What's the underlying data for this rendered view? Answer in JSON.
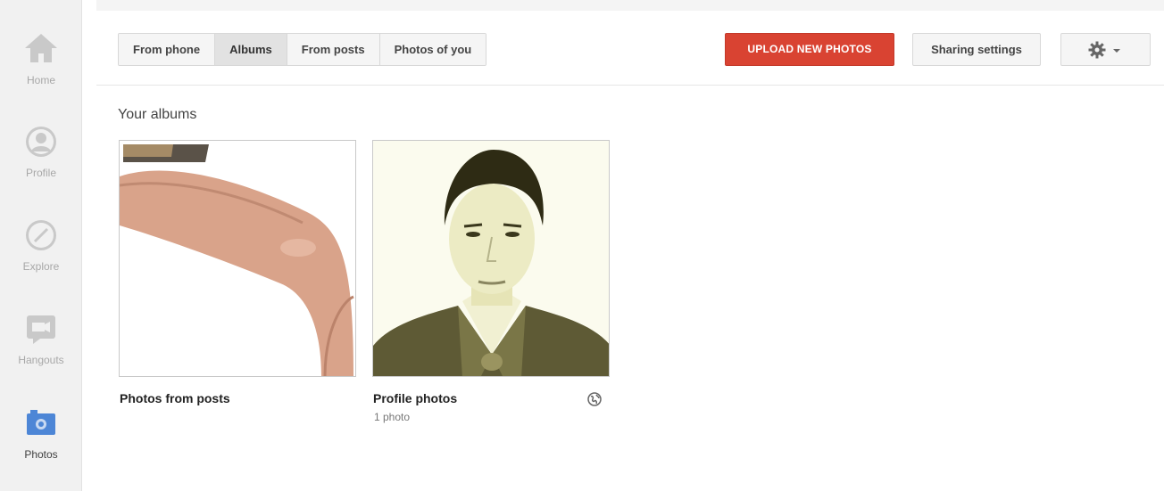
{
  "nav": {
    "items": [
      {
        "label": "Home",
        "icon": "home-icon"
      },
      {
        "label": "Profile",
        "icon": "profile-icon"
      },
      {
        "label": "Explore",
        "icon": "compass-icon"
      },
      {
        "label": "Hangouts",
        "icon": "hangouts-icon"
      },
      {
        "label": "Photos",
        "icon": "camera-icon",
        "active": true
      }
    ]
  },
  "tabs": [
    {
      "label": "From phone"
    },
    {
      "label": "Albums",
      "selected": true
    },
    {
      "label": "From posts"
    },
    {
      "label": "Photos of you"
    }
  ],
  "toolbar": {
    "upload_label": "UPLOAD NEW PHOTOS",
    "sharing_label": "Sharing settings",
    "settings_icon": "gear-icon"
  },
  "content": {
    "section_title": "Your albums",
    "albums": [
      {
        "title": "Photos from posts",
        "count": ""
      },
      {
        "title": "Profile photos",
        "count": "1 photo",
        "visibility_icon": "globe-icon"
      }
    ]
  },
  "colors": {
    "accent_red": "#d94332",
    "nav_bg": "#f1f1f1",
    "active_icon_blue": "#4d86d6"
  }
}
